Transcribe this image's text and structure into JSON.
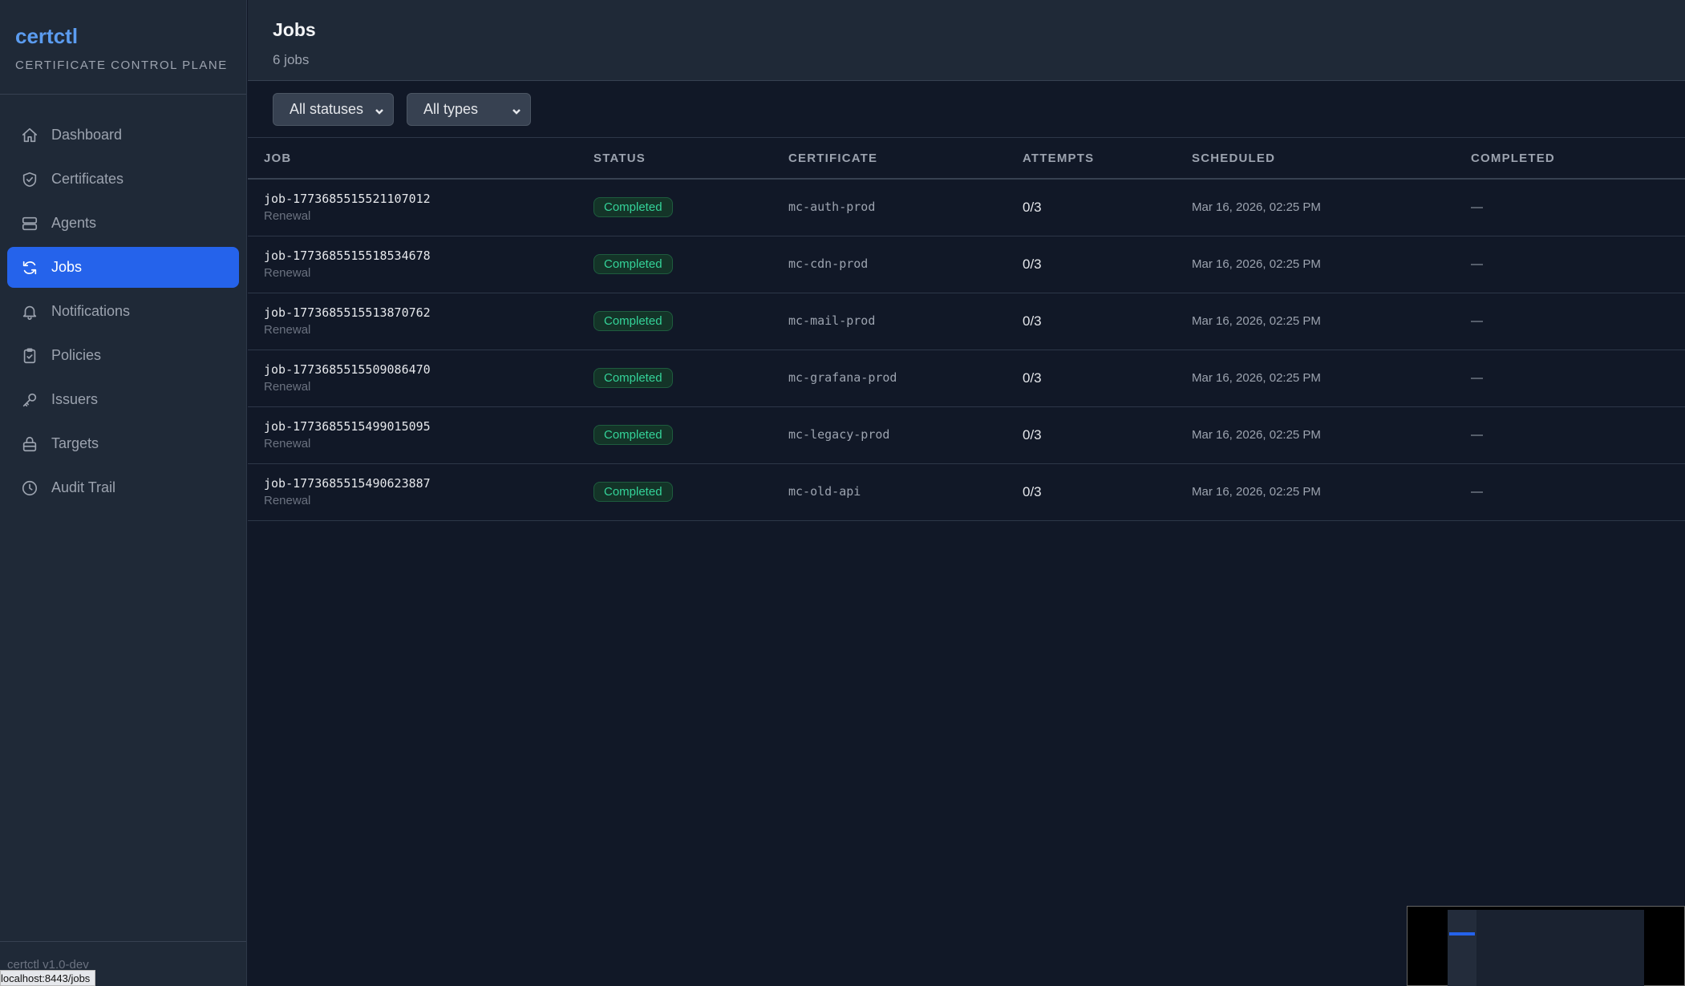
{
  "brand": {
    "name": "certctl",
    "subtitle": "CERTIFICATE CONTROL PLANE"
  },
  "sidebar": {
    "items": [
      {
        "label": "Dashboard",
        "icon": "home-icon",
        "active": false
      },
      {
        "label": "Certificates",
        "icon": "shield-check-icon",
        "active": false
      },
      {
        "label": "Agents",
        "icon": "server-icon",
        "active": false
      },
      {
        "label": "Jobs",
        "icon": "refresh-icon",
        "active": true
      },
      {
        "label": "Notifications",
        "icon": "bell-icon",
        "active": false
      },
      {
        "label": "Policies",
        "icon": "clipboard-check-icon",
        "active": false
      },
      {
        "label": "Issuers",
        "icon": "key-icon",
        "active": false
      },
      {
        "label": "Targets",
        "icon": "lock-icon",
        "active": false
      },
      {
        "label": "Audit Trail",
        "icon": "clock-icon",
        "active": false
      }
    ],
    "version": "certctl v1.0-dev"
  },
  "status_bar": {
    "url": "localhost:8443/jobs"
  },
  "header": {
    "title": "Jobs",
    "subtitle": "6 jobs"
  },
  "filters": {
    "status": "All statuses",
    "type": "All types"
  },
  "table": {
    "columns": [
      "JOB",
      "STATUS",
      "CERTIFICATE",
      "ATTEMPTS",
      "SCHEDULED",
      "COMPLETED"
    ],
    "rows": [
      {
        "id": "job-1773685515521107012",
        "type": "Renewal",
        "status": "Completed",
        "certificate": "mc-auth-prod",
        "attempts": "0/3",
        "scheduled": "Mar 16, 2026, 02:25 PM",
        "completed": "—"
      },
      {
        "id": "job-1773685515518534678",
        "type": "Renewal",
        "status": "Completed",
        "certificate": "mc-cdn-prod",
        "attempts": "0/3",
        "scheduled": "Mar 16, 2026, 02:25 PM",
        "completed": "—"
      },
      {
        "id": "job-1773685515513870762",
        "type": "Renewal",
        "status": "Completed",
        "certificate": "mc-mail-prod",
        "attempts": "0/3",
        "scheduled": "Mar 16, 2026, 02:25 PM",
        "completed": "—"
      },
      {
        "id": "job-1773685515509086470",
        "type": "Renewal",
        "status": "Completed",
        "certificate": "mc-grafana-prod",
        "attempts": "0/3",
        "scheduled": "Mar 16, 2026, 02:25 PM",
        "completed": "—"
      },
      {
        "id": "job-1773685515499015095",
        "type": "Renewal",
        "status": "Completed",
        "certificate": "mc-legacy-prod",
        "attempts": "0/3",
        "scheduled": "Mar 16, 2026, 02:25 PM",
        "completed": "—"
      },
      {
        "id": "job-1773685515490623887",
        "type": "Renewal",
        "status": "Completed",
        "certificate": "mc-old-api",
        "attempts": "0/3",
        "scheduled": "Mar 16, 2026, 02:25 PM",
        "completed": "—"
      }
    ]
  },
  "colors": {
    "accent": "#2563eb",
    "brand": "#5b9cf0",
    "success": "#34d399",
    "background": "#111827",
    "sidebar": "#1f2937"
  }
}
